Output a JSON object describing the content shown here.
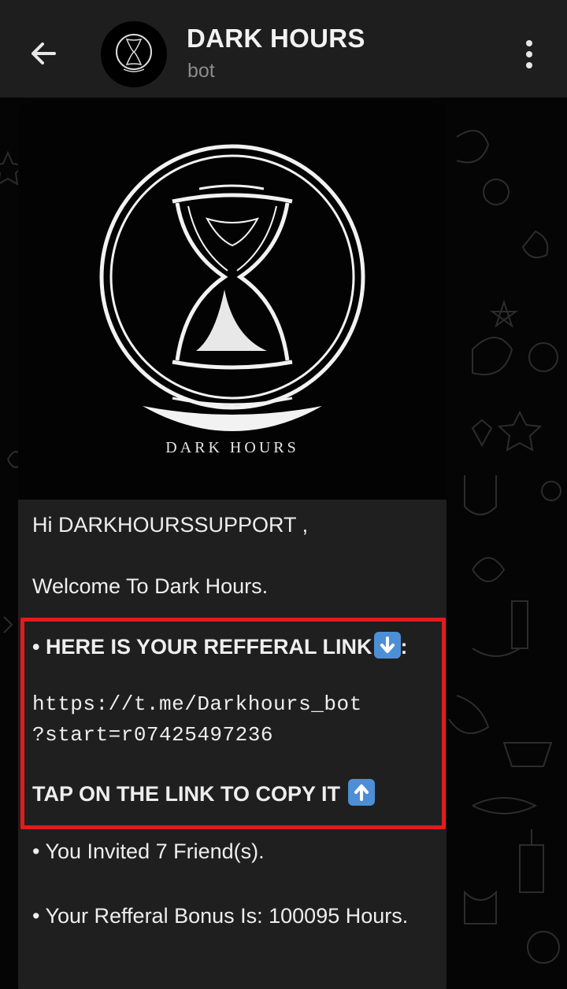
{
  "header": {
    "title": "DARK HOURS",
    "subtitle": "bot",
    "back_icon": "arrow-left-icon",
    "menu_icon": "more-vertical-icon"
  },
  "message": {
    "image_caption": "DARK HOURS",
    "greeting": "Hi DARKHOURSSUPPORT ,",
    "welcome": "Welcome To Dark Hours.",
    "referral_heading": "• HERE IS YOUR REFFERAL LINK",
    "referral_heading_suffix": ":",
    "referral_link_line1": "https://t.me/Darkhours_bot",
    "referral_link_line2": "?start=r07425497236",
    "tap_to_copy": "TAP ON THE LINK TO COPY IT",
    "invited": "• You Invited 7 Friend(s).",
    "bonus": "• Your Refferal Bonus Is: 100095 Hours."
  },
  "colors": {
    "highlight_border": "#e21b1b",
    "header_bg": "#1e1e1e",
    "bubble_bg": "#1f1f1f",
    "emoji_blue": "#4d8fd6"
  }
}
